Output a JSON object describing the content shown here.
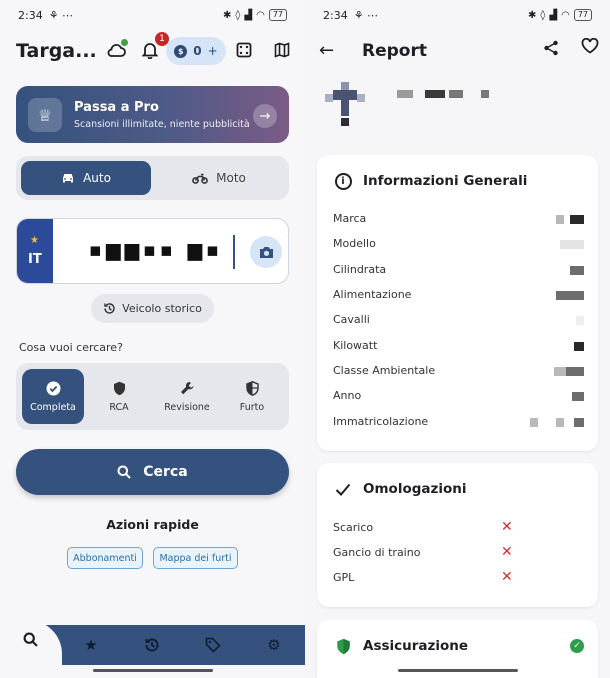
{
  "status": {
    "time": "2:34",
    "battery": "77"
  },
  "search_screen": {
    "app_title": "Targa...",
    "notification_count": "1",
    "coins": "0",
    "coins_add": "+",
    "pro_banner": {
      "title": "Passa a Pro",
      "subtitle": "Scansioni illimitate, niente pubblicità"
    },
    "vehicle_types": [
      {
        "label": "Auto",
        "icon": "car-icon",
        "selected": true
      },
      {
        "label": "Moto",
        "icon": "motorcycle-icon",
        "selected": false
      }
    ],
    "plate": {
      "country_code": "IT",
      "value": "▪▆▆▪▪ ▆▪"
    },
    "historic_button": "Veicolo storico",
    "search_question": "Cosa vuoi cercare?",
    "search_types": [
      {
        "label": "Completa",
        "icon": "check-circle-icon",
        "selected": true
      },
      {
        "label": "RCA",
        "icon": "shield-icon",
        "selected": false
      },
      {
        "label": "Revisione",
        "icon": "wrench-icon",
        "selected": false
      },
      {
        "label": "Furto",
        "icon": "shield-half-icon",
        "selected": false
      }
    ],
    "search_button": "Cerca",
    "quick_actions_title": "Azioni rapide",
    "quick_actions": [
      "Abbonamenti",
      "Mappa dei furti"
    ],
    "nav": [
      "search-icon",
      "star-icon",
      "history-icon",
      "tag-icon",
      "gear-icon"
    ]
  },
  "report_screen": {
    "title": "Report",
    "general_info": {
      "title": "Informazioni Generali",
      "rows": [
        "Marca",
        "Modello",
        "Cilindrata",
        "Alimentazione",
        "Cavalli",
        "Kilowatt",
        "Classe Ambientale",
        "Anno",
        "Immatricolazione"
      ]
    },
    "homologations": {
      "title": "Omologazioni",
      "rows": [
        "Scarico",
        "Gancio di traino",
        "GPL"
      ],
      "x_mark": "✕"
    },
    "insurance": {
      "title": "Assicurazione"
    }
  },
  "colors": {
    "primary": "#35527e",
    "accent_light": "#d6e4f7",
    "error": "#d32f2f",
    "success": "#2e9d4a"
  }
}
